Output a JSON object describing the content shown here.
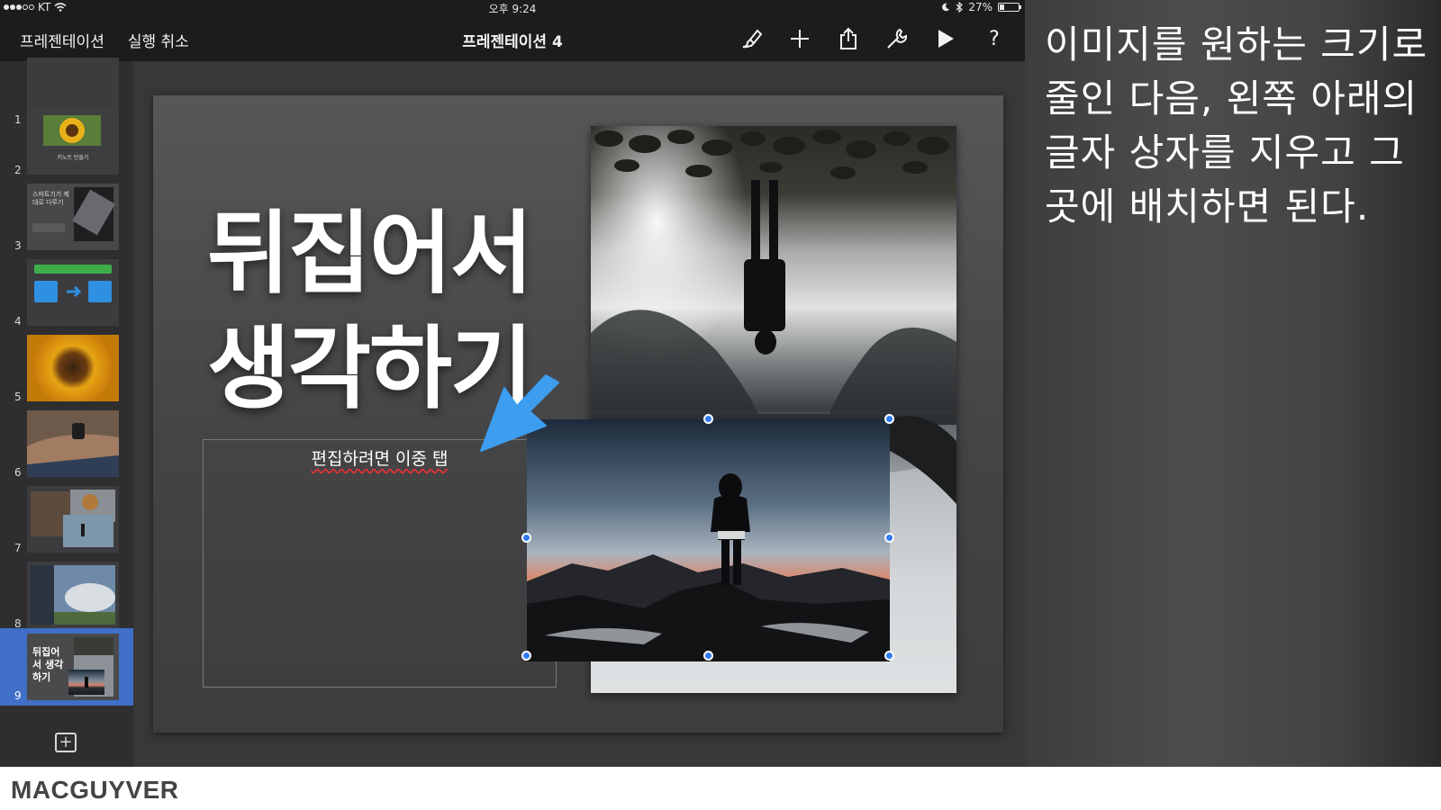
{
  "status_bar": {
    "carrier": "KT",
    "time": "오후 9:24",
    "battery": "27%",
    "battery_level": 0.27
  },
  "toolbar": {
    "back_label": "프레젠테이션",
    "undo_label": "실행 취소",
    "title": "프레젠테이션 4",
    "icons": [
      "format-brush-icon",
      "plus-icon",
      "share-icon",
      "wrench-icon",
      "play-icon",
      "help-icon"
    ],
    "help_glyph": "?"
  },
  "sidebar": {
    "slides": [
      {
        "number": "1"
      },
      {
        "number": "2",
        "caption": "키노트 만들기"
      },
      {
        "number": "3",
        "caption": "스마트기기 제대로 다루기"
      },
      {
        "number": "4"
      },
      {
        "number": "5"
      },
      {
        "number": "6"
      },
      {
        "number": "7"
      },
      {
        "number": "8"
      },
      {
        "number": "9",
        "caption": "뒤집어서 생각하기",
        "selected": true
      }
    ],
    "add_glyph": "+"
  },
  "slide": {
    "title": "뒤집어서 생각하기",
    "placeholder": "편집하려면 이중 탭"
  },
  "caption": "이미지를 원하는 크기로 줄인 다음, 왼쪽 아래의 글자 상자를 지우고 그 곳에 배치하면 된다.",
  "footer": {
    "logo": "MACGUYVER"
  },
  "colors": {
    "selection": "#3f6fc6",
    "handle": "#2f7bf5",
    "arrow": "#3d9ef0"
  }
}
